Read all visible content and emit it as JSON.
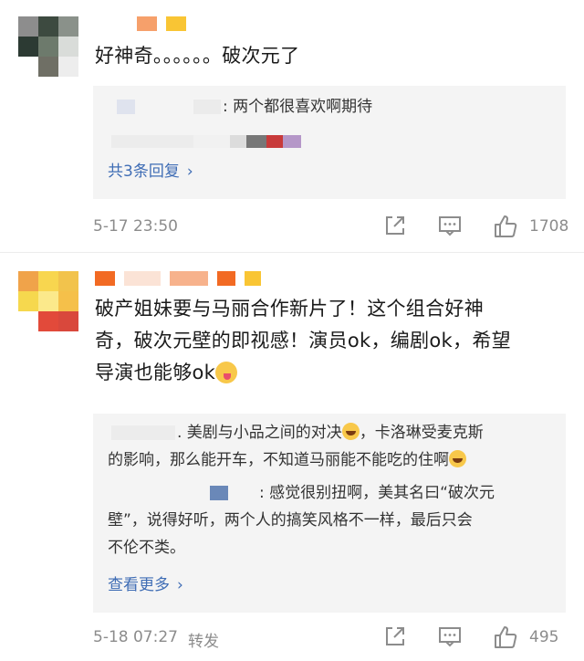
{
  "comments": [
    {
      "text": "好神奇。。。。。。破次元了",
      "reply_preview": ": 两个都很喜欢啊期待",
      "more_label": "共3条回复",
      "time": "5-17 23:50",
      "likes": "1708"
    },
    {
      "text_line1": "破产姐妹要与马丽合作新片了！这个组合好神",
      "text_line2": "奇，破次元壁的即视感！演员ok，编剧ok，希望",
      "text_line3": "导演也能够ok",
      "reply1_line1": ". 美剧与小品之间的对决",
      "reply1_line1b": "，卡洛琳受麦克斯",
      "reply1_line2": "的影响，那么能开车，不知道马丽能不能吃的住啊",
      "reply2_line1": ": 感觉很别扭啊，美其名曰“破次元",
      "reply2_line2": "壁”，说得好听，两个人的搞笑风格不一样，最后只会",
      "reply2_line3": "不伦不类。",
      "more_label": "查看更多",
      "time": "5-18 07:27",
      "forward_label": "转发",
      "likes": "495"
    }
  ],
  "icons": {
    "share": "share-icon",
    "comment": "comment-icon",
    "like": "thumbs-up-icon",
    "chevron": "chevron-right-icon"
  },
  "colors": {
    "link": "#3f6db5",
    "meta": "#8c8c8c",
    "reply_bg": "#f4f4f4"
  }
}
